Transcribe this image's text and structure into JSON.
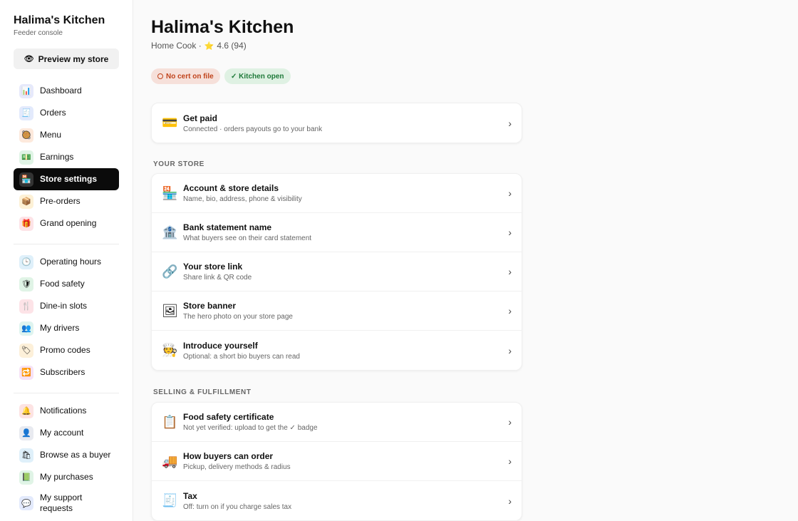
{
  "sidebar": {
    "brand_title": "Halima's Kitchen",
    "brand_sub": "Feeder console",
    "preview_label": "Preview my store",
    "items": [
      {
        "label": "Dashboard",
        "icon": "📊",
        "bg": "#e6e9fb"
      },
      {
        "label": "Orders",
        "icon": "🧾",
        "bg": "#e3eafc"
      },
      {
        "label": "Menu",
        "icon": "🥘",
        "bg": "#fde9dc"
      },
      {
        "label": "Earnings",
        "icon": "💵",
        "bg": "#e0f4e6"
      },
      {
        "label": "Store settings",
        "icon": "🏪",
        "bg": "#333333"
      },
      {
        "label": "Pre-orders",
        "icon": "📦",
        "bg": "#fdf1d6"
      },
      {
        "label": "Grand opening",
        "icon": "🎁",
        "bg": "#fde3e7"
      },
      {
        "label": "Operating hours",
        "icon": "🕒",
        "bg": "#dff0fa"
      },
      {
        "label": "Food safety",
        "icon": "🛡",
        "bg": "#e0f4e6"
      },
      {
        "label": "Dine-in slots",
        "icon": "🍴",
        "bg": "#fde3e7"
      },
      {
        "label": "My drivers",
        "icon": "👥",
        "bg": "#dff4ef"
      },
      {
        "label": "Promo codes",
        "icon": "🏷",
        "bg": "#fdf0d9"
      },
      {
        "label": "Subscribers",
        "icon": "🔁",
        "bg": "#f6e2f6"
      },
      {
        "label": "Notifications",
        "icon": "🔔",
        "bg": "#fde3e3"
      },
      {
        "label": "My account",
        "icon": "👤",
        "bg": "#e8eaf0"
      },
      {
        "label": "Browse as a buyer",
        "icon": "🛍",
        "bg": "#dff0fa"
      },
      {
        "label": "My purchases",
        "icon": "📗",
        "bg": "#e0f4e6"
      },
      {
        "label": "My support requests",
        "icon": "💬",
        "bg": "#e3eafc"
      }
    ]
  },
  "header": {
    "title": "Halima's Kitchen",
    "meta_role": "Home Cook ·",
    "star": "⭐",
    "rating": "4.6 (94)"
  },
  "badges": {
    "cert": "No cert on file",
    "kitchen": "✓ Kitchen open"
  },
  "get_paid": {
    "icon": "💳",
    "title": "Get paid",
    "sub": "Connected · orders payouts go to your bank"
  },
  "sections": {
    "your_store": "YOUR STORE",
    "selling": "SELLING & FULFILLMENT"
  },
  "store_rows": [
    {
      "icon": "🏪",
      "title": "Account & store details",
      "sub": "Name, bio, address, phone & visibility"
    },
    {
      "icon": "🏦",
      "title": "Bank statement name",
      "sub": "What buyers see on their card statement"
    },
    {
      "icon": "🔗",
      "title": "Your store link",
      "sub": "Share link & QR code"
    },
    {
      "icon": "🖼",
      "title": "Store banner",
      "sub": "The hero photo on your store page"
    },
    {
      "icon": "🧑‍🍳",
      "title": "Introduce yourself",
      "sub": "Optional: a short bio buyers can read"
    }
  ],
  "selling_rows": [
    {
      "icon": "📋",
      "title": "Food safety certificate",
      "sub": "Not yet verified: upload to get the ✓ badge"
    },
    {
      "icon": "🚚",
      "title": "How buyers can order",
      "sub": "Pickup, delivery methods & radius"
    },
    {
      "icon": "🧾",
      "title": "Tax",
      "sub": "Off: turn on if you charge sales tax"
    }
  ],
  "chevron": "›"
}
